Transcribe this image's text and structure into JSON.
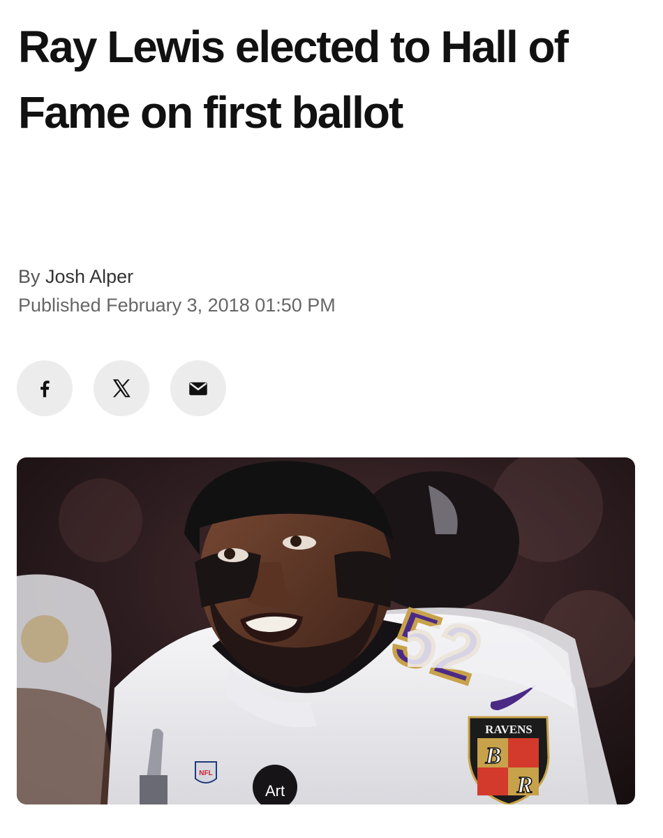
{
  "article": {
    "headline": "Ray Lewis elected to Hall of Fame on first ballot",
    "byline_prefix": "By",
    "author": "Josh Alper",
    "published": "Published February 3, 2018 01:50 PM"
  },
  "share": {
    "buttons": [
      {
        "name": "facebook",
        "icon": "facebook-icon"
      },
      {
        "name": "x",
        "icon": "x-icon"
      },
      {
        "name": "email",
        "icon": "mail-icon"
      }
    ]
  },
  "photo": {
    "jersey_number": "52",
    "patch_text": "RAVENS",
    "patch_letters": "B",
    "patch_letters_2": "R",
    "badge_text": "Art",
    "nfl_text": "NFL",
    "colors": {
      "jersey": "#f2f2f4",
      "purple": "#4b2a86",
      "gold": "#c8a24a",
      "background": "#2a1a1c"
    }
  }
}
